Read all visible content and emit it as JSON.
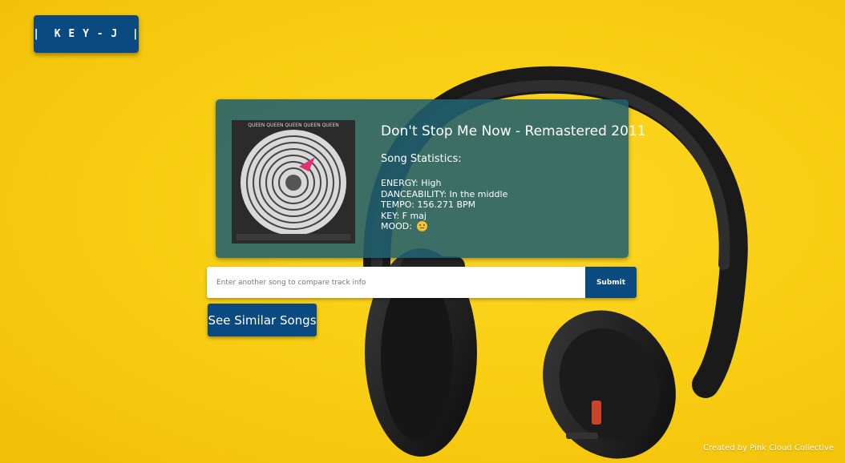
{
  "brand": {
    "logo_label": "|  K E Y - J  |"
  },
  "song": {
    "title": "Don't Stop Me Now - Remastered 2011",
    "album_art_text": "QUEEN QUEEN QUEEN QUEEN QUEEN",
    "stats_heading": "Song Statistics:",
    "stats": {
      "energy": "ENERGY: High",
      "danceability": "DANCEABILITY: In the middle",
      "tempo": "TEMPO: 156.271 BPM",
      "key": "KEY: F maj",
      "mood": "MOOD:"
    }
  },
  "search": {
    "placeholder": "Enter another song to compare track info",
    "value": "",
    "submit_label": "Submit"
  },
  "similar": {
    "button_label": "See Similar Songs"
  },
  "footer": {
    "credit": "Created by Pink Cloud Collective"
  },
  "colors": {
    "background_yellow": "#f9cf14",
    "button_blue": "#0b4a80",
    "card_teal": "#21606e"
  },
  "icons": {
    "mood": "neutral-smiley-icon"
  }
}
